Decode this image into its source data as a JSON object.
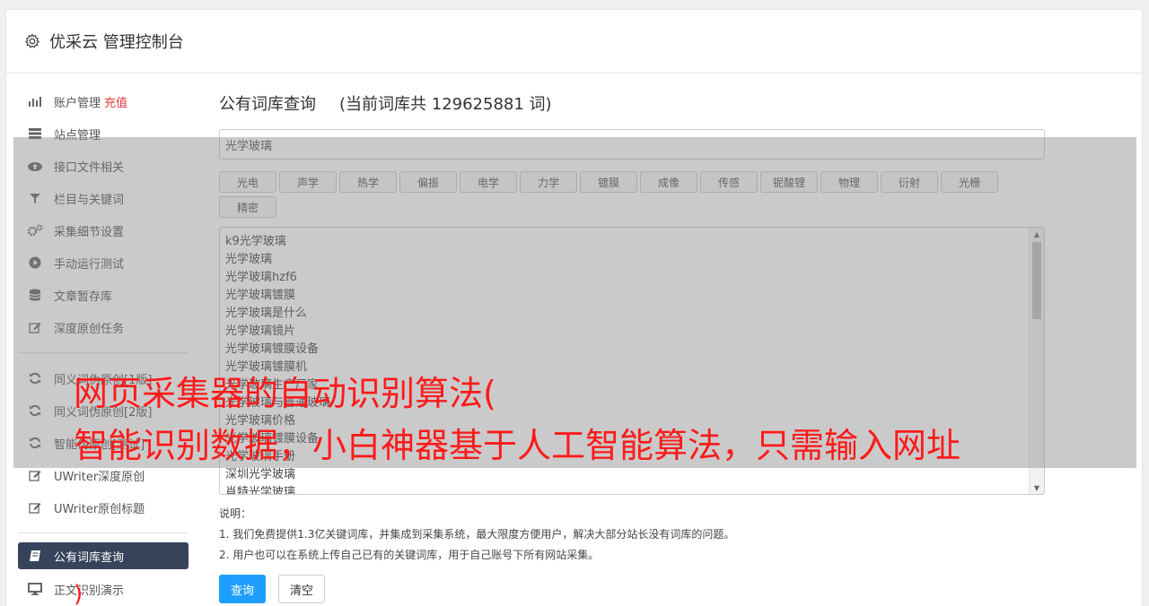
{
  "header": {
    "title": "优采云 管理控制台"
  },
  "sidebar": {
    "items": [
      {
        "label": "账户管理",
        "extra": "充值",
        "icon": "bar-chart-icon"
      },
      {
        "label": "站点管理",
        "icon": "server-icon"
      },
      {
        "label": "接口文件相关",
        "icon": "cloud-upload-icon"
      },
      {
        "label": "栏目与关键词",
        "icon": "filter-icon"
      },
      {
        "label": "采集细节设置",
        "icon": "gears-icon"
      },
      {
        "label": "手动运行测试",
        "icon": "play-icon"
      },
      {
        "label": "文章暂存库",
        "icon": "database-icon"
      },
      {
        "label": "深度原创任务",
        "icon": "edit-icon"
      }
    ],
    "items2": [
      {
        "label": "同义词伪原创[1版]",
        "icon": "refresh-icon"
      },
      {
        "label": "同义词伪原创[2版]",
        "icon": "refresh-icon"
      },
      {
        "label": "智能伪原创[测试]",
        "icon": "refresh-icon"
      },
      {
        "label": "UWriter深度原创",
        "icon": "edit-icon"
      },
      {
        "label": "UWriter原创标题",
        "icon": "edit-icon"
      }
    ],
    "items3": [
      {
        "label": "公有词库查询",
        "icon": "book-icon"
      },
      {
        "label": "正文识别演示",
        "icon": "monitor-icon"
      }
    ]
  },
  "main": {
    "title": "公有词库查询",
    "count_text": "(当前词库共 129625881 词)",
    "search_value": "光学玻璃",
    "tags": [
      "光电",
      "声学",
      "热学",
      "偏振",
      "电学",
      "力学",
      "镀膜",
      "成像",
      "传感",
      "铌酸锂",
      "物理",
      "衍射",
      "光栅",
      "精密"
    ],
    "results": [
      "k9光学玻璃",
      "光学玻璃",
      "光学玻璃hzf6",
      "光学玻璃镀膜",
      "光学玻璃是什么",
      "光学玻璃镜片",
      "光学玻璃镀膜设备",
      "光学玻璃镀膜机",
      "光学玻璃生产厂家",
      "光学玻璃与普通玻璃",
      "光学玻璃价格",
      "光学玻璃镀膜设备",
      "光学玻璃手册",
      "深圳光学玻璃",
      "肖特光学玻璃"
    ],
    "notes_title": "说明：",
    "notes": [
      "1. 我们免费提供1.3亿关键词库，并集成到采集系统，最大限度方便用户，解决大部分站长没有词库的问题。",
      "2. 用户也可以在系统上传自己已有的关键词库，用于自己账号下所有网站采集。"
    ],
    "query_button": "查询",
    "clear_button": "清空"
  },
  "overlay": {
    "line1": "网页采集器的自动识别算法(",
    "line2": "智能识别数据，小白神器基于人工智能算法，只需输入网址",
    "paren": ")"
  }
}
